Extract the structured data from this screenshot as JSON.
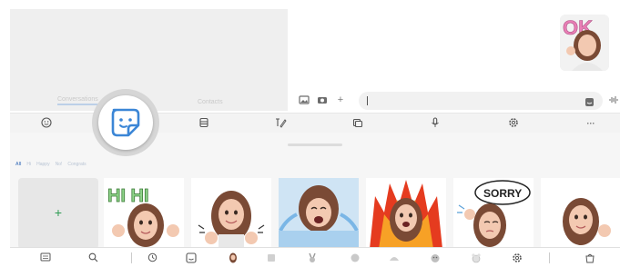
{
  "conversations_pane": {
    "tab_conversations": "Conversations",
    "tab_contacts": "Contacts"
  },
  "chat": {
    "received_sticker_text": "OK",
    "message_time": ""
  },
  "compose": {
    "gallery_icon": "gallery-icon",
    "camera_icon": "camera-icon",
    "add_icon": "+",
    "input_value": "",
    "sticker_icon": "sticker-icon",
    "voice_icon": "voice-wave-icon"
  },
  "toolbar": {
    "items": [
      "emoji-icon",
      "sticker-icon",
      "gif-icon",
      "handwriting-icon",
      "clipboard-icon",
      "mic-icon",
      "settings-icon",
      "more-icon"
    ],
    "more_label": "···"
  },
  "sticker_panel": {
    "filters": [
      "All",
      "Hi",
      "Happy",
      "No!",
      "Congrats"
    ],
    "add_label": "+",
    "stickers": [
      {
        "name": "sticker-hi-hi",
        "caption": "HI HI",
        "bg": "#ffffff"
      },
      {
        "name": "sticker-thumbs-up",
        "caption": "",
        "bg": "#ffffff"
      },
      {
        "name": "sticker-crying",
        "caption": "",
        "bg": "#cfe4f4"
      },
      {
        "name": "sticker-fire",
        "caption": "",
        "bg": "#ffffff"
      },
      {
        "name": "sticker-sorry",
        "caption": "SORRY",
        "bg": "#ffffff"
      },
      {
        "name": "sticker-wave",
        "caption": "",
        "bg": "#ffffff"
      }
    ]
  },
  "bottom_bar": {
    "items": [
      "keyboard-icon",
      "search-icon",
      "recent-icon",
      "emoji-sticker-icon",
      "avatar-icon",
      "pack-icon",
      "bunny-icon",
      "pack-icon",
      "pack-icon",
      "pack-icon",
      "pack-icon",
      "settings-icon",
      "store-icon"
    ]
  },
  "colors": {
    "accent_green": "#2c9b52",
    "accent_blue": "#3b86d6",
    "hair": "#7a4a35",
    "skin": "#f3c9b1"
  }
}
